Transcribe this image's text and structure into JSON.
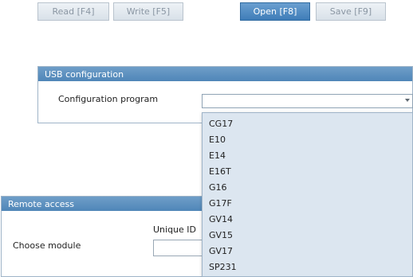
{
  "toolbar": {
    "read_label": "Read [F4]",
    "write_label": "Write [F5]",
    "open_label": "Open [F8]",
    "save_label": "Save [F9]"
  },
  "usb_config": {
    "title": "USB configuration",
    "program_label": "Configuration program",
    "program_value": "",
    "options": [
      "CG17",
      "E10",
      "E14",
      "E16T",
      "G16",
      "G17F",
      "GV14",
      "GV15",
      "GV17",
      "SP231"
    ]
  },
  "remote_access": {
    "title": "Remote access",
    "choose_module_label": "Choose module",
    "unique_id_label": "Unique ID",
    "unique_id_value": ""
  },
  "icons": {
    "dropdown_caret": "chevron-down-icon",
    "info": "info-icon"
  },
  "colors": {
    "header_blue": "#4f86b8",
    "active_button": "#3f7db8",
    "dropdown_bg": "#dce6f0"
  }
}
